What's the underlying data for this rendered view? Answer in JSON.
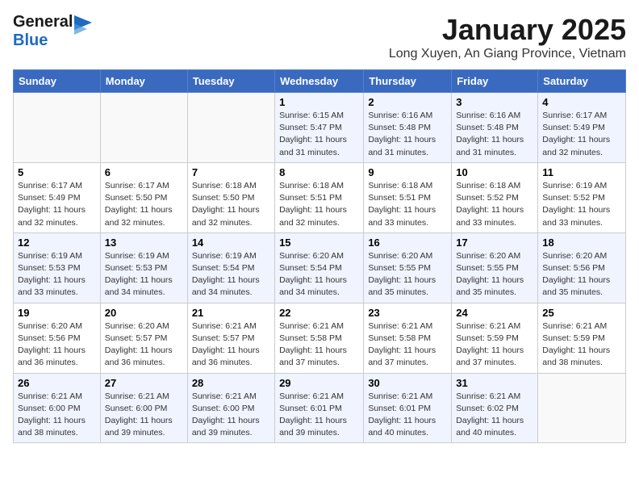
{
  "header": {
    "logo_general": "General",
    "logo_blue": "Blue",
    "month_title": "January 2025",
    "subtitle": "Long Xuyen, An Giang Province, Vietnam"
  },
  "weekdays": [
    "Sunday",
    "Monday",
    "Tuesday",
    "Wednesday",
    "Thursday",
    "Friday",
    "Saturday"
  ],
  "weeks": [
    [
      {
        "day": "",
        "info": ""
      },
      {
        "day": "",
        "info": ""
      },
      {
        "day": "",
        "info": ""
      },
      {
        "day": "1",
        "info": "Sunrise: 6:15 AM\nSunset: 5:47 PM\nDaylight: 11 hours\nand 31 minutes."
      },
      {
        "day": "2",
        "info": "Sunrise: 6:16 AM\nSunset: 5:48 PM\nDaylight: 11 hours\nand 31 minutes."
      },
      {
        "day": "3",
        "info": "Sunrise: 6:16 AM\nSunset: 5:48 PM\nDaylight: 11 hours\nand 31 minutes."
      },
      {
        "day": "4",
        "info": "Sunrise: 6:17 AM\nSunset: 5:49 PM\nDaylight: 11 hours\nand 32 minutes."
      }
    ],
    [
      {
        "day": "5",
        "info": "Sunrise: 6:17 AM\nSunset: 5:49 PM\nDaylight: 11 hours\nand 32 minutes."
      },
      {
        "day": "6",
        "info": "Sunrise: 6:17 AM\nSunset: 5:50 PM\nDaylight: 11 hours\nand 32 minutes."
      },
      {
        "day": "7",
        "info": "Sunrise: 6:18 AM\nSunset: 5:50 PM\nDaylight: 11 hours\nand 32 minutes."
      },
      {
        "day": "8",
        "info": "Sunrise: 6:18 AM\nSunset: 5:51 PM\nDaylight: 11 hours\nand 32 minutes."
      },
      {
        "day": "9",
        "info": "Sunrise: 6:18 AM\nSunset: 5:51 PM\nDaylight: 11 hours\nand 33 minutes."
      },
      {
        "day": "10",
        "info": "Sunrise: 6:18 AM\nSunset: 5:52 PM\nDaylight: 11 hours\nand 33 minutes."
      },
      {
        "day": "11",
        "info": "Sunrise: 6:19 AM\nSunset: 5:52 PM\nDaylight: 11 hours\nand 33 minutes."
      }
    ],
    [
      {
        "day": "12",
        "info": "Sunrise: 6:19 AM\nSunset: 5:53 PM\nDaylight: 11 hours\nand 33 minutes."
      },
      {
        "day": "13",
        "info": "Sunrise: 6:19 AM\nSunset: 5:53 PM\nDaylight: 11 hours\nand 34 minutes."
      },
      {
        "day": "14",
        "info": "Sunrise: 6:19 AM\nSunset: 5:54 PM\nDaylight: 11 hours\nand 34 minutes."
      },
      {
        "day": "15",
        "info": "Sunrise: 6:20 AM\nSunset: 5:54 PM\nDaylight: 11 hours\nand 34 minutes."
      },
      {
        "day": "16",
        "info": "Sunrise: 6:20 AM\nSunset: 5:55 PM\nDaylight: 11 hours\nand 35 minutes."
      },
      {
        "day": "17",
        "info": "Sunrise: 6:20 AM\nSunset: 5:55 PM\nDaylight: 11 hours\nand 35 minutes."
      },
      {
        "day": "18",
        "info": "Sunrise: 6:20 AM\nSunset: 5:56 PM\nDaylight: 11 hours\nand 35 minutes."
      }
    ],
    [
      {
        "day": "19",
        "info": "Sunrise: 6:20 AM\nSunset: 5:56 PM\nDaylight: 11 hours\nand 36 minutes."
      },
      {
        "day": "20",
        "info": "Sunrise: 6:20 AM\nSunset: 5:57 PM\nDaylight: 11 hours\nand 36 minutes."
      },
      {
        "day": "21",
        "info": "Sunrise: 6:21 AM\nSunset: 5:57 PM\nDaylight: 11 hours\nand 36 minutes."
      },
      {
        "day": "22",
        "info": "Sunrise: 6:21 AM\nSunset: 5:58 PM\nDaylight: 11 hours\nand 37 minutes."
      },
      {
        "day": "23",
        "info": "Sunrise: 6:21 AM\nSunset: 5:58 PM\nDaylight: 11 hours\nand 37 minutes."
      },
      {
        "day": "24",
        "info": "Sunrise: 6:21 AM\nSunset: 5:59 PM\nDaylight: 11 hours\nand 37 minutes."
      },
      {
        "day": "25",
        "info": "Sunrise: 6:21 AM\nSunset: 5:59 PM\nDaylight: 11 hours\nand 38 minutes."
      }
    ],
    [
      {
        "day": "26",
        "info": "Sunrise: 6:21 AM\nSunset: 6:00 PM\nDaylight: 11 hours\nand 38 minutes."
      },
      {
        "day": "27",
        "info": "Sunrise: 6:21 AM\nSunset: 6:00 PM\nDaylight: 11 hours\nand 39 minutes."
      },
      {
        "day": "28",
        "info": "Sunrise: 6:21 AM\nSunset: 6:00 PM\nDaylight: 11 hours\nand 39 minutes."
      },
      {
        "day": "29",
        "info": "Sunrise: 6:21 AM\nSunset: 6:01 PM\nDaylight: 11 hours\nand 39 minutes."
      },
      {
        "day": "30",
        "info": "Sunrise: 6:21 AM\nSunset: 6:01 PM\nDaylight: 11 hours\nand 40 minutes."
      },
      {
        "day": "31",
        "info": "Sunrise: 6:21 AM\nSunset: 6:02 PM\nDaylight: 11 hours\nand 40 minutes."
      },
      {
        "day": "",
        "info": ""
      }
    ]
  ]
}
